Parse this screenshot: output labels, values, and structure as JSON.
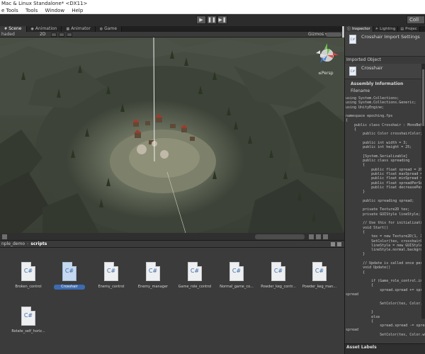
{
  "window": {
    "title": "Mac & Linux Standalone* <DX11>"
  },
  "menu": [
    "e Tools",
    "Tools",
    "Window",
    "Help"
  ],
  "toolbar": {
    "play": "▶",
    "pause": "❚❚",
    "step": "▶❚",
    "collab": "Coll"
  },
  "scene_tabs": [
    {
      "label": "Scene",
      "icon": "scene-icon"
    },
    {
      "label": "Animation",
      "icon": "animation-icon"
    },
    {
      "label": "Animator",
      "icon": "animator-icon"
    },
    {
      "label": "Game",
      "icon": "game-icon"
    }
  ],
  "scene_bar": {
    "shading": "haded",
    "mode": "2D",
    "gizmos": "Gizmos ▾"
  },
  "scene": {
    "projection_label": "≤Persp"
  },
  "project": {
    "breadcrumb": [
      "nple_demo",
      "scripts"
    ],
    "assets": [
      {
        "name": "Broken_control",
        "icon": "C#",
        "selected": false
      },
      {
        "name": "Crosshair",
        "icon": "C#",
        "selected": true
      },
      {
        "name": "Enemy_control",
        "icon": "C#",
        "selected": false
      },
      {
        "name": "Enemy_manager",
        "icon": "C#",
        "selected": false
      },
      {
        "name": "Game_role_control",
        "icon": "C#",
        "selected": false
      },
      {
        "name": "Normal_game_co...",
        "icon": "C#",
        "selected": false
      },
      {
        "name": "Powder_keg_contr...",
        "icon": "C#",
        "selected": false
      },
      {
        "name": "Powder_keg_man...",
        "icon": "C#",
        "selected": false
      },
      {
        "name": "Rotate_self_horiz...",
        "icon": "C#",
        "selected": false
      },
      {
        "name": "...",
        "icon": "",
        "selected": false
      }
    ]
  },
  "inspector": {
    "tabs": [
      "Inspector",
      "Lighting",
      "Projec"
    ],
    "header_title": "Crosshair Import Settings",
    "imported_object_label": "Imported Object",
    "object_name": "Crosshair",
    "assembly_info": "Assembly Information",
    "filename_label": "Filename",
    "code": "using System.Collections;\nusing System.Collections.Generic;\nusing UnityEngine;\n\nnamespace epoching.fps\n{\n    public class Crosshair : MonoBehavi\n    {\n        public Color crosshairColor;    //Th\n\n        public int width = 3;        //Crossh\n        public int height = 25;     //Crossh\n\n        [System.Serializable]\n        public class spreading\n        {\n            public float spread = 20.0f;\n            public float maxSpread = 60.0\n            public float minSpread = 20.0f\n            public float spreadPerSecond =\n            public float decreasePerSecon\n        }\n\n        public spreading spread;\n\n        private Texture2D tex;\n        private GUIStyle lineStyle;\n\n        // Use this for initialization\n        void Start()\n        {\n            tex = new Texture2D(1, 1);\n            SetColor(tex, crosshairColor);\n            lineStyle = new GUIStyle();\n            lineStyle.normal.background =\n        }\n\n        // Update is called once per frame\n        void Update()\n        {\n\n            if (Game_role_control.instance\n            {\n                spread.spread += spread.s\nspread\n\n                SetColor(tex, Color.red); //C\n\n            }\n            else\n            {\n                spread.spread -= spread.de\nspread\n                SetColor(tex, Color.white);",
    "asset_labels": "Asset Labels"
  },
  "colors": {
    "toolbar": "#2c2c2c",
    "panel": "#3b3b3b",
    "selection": "#3d6bb0",
    "terrain_dark": "#3d4338",
    "terrain_center": "#8a8c74"
  }
}
